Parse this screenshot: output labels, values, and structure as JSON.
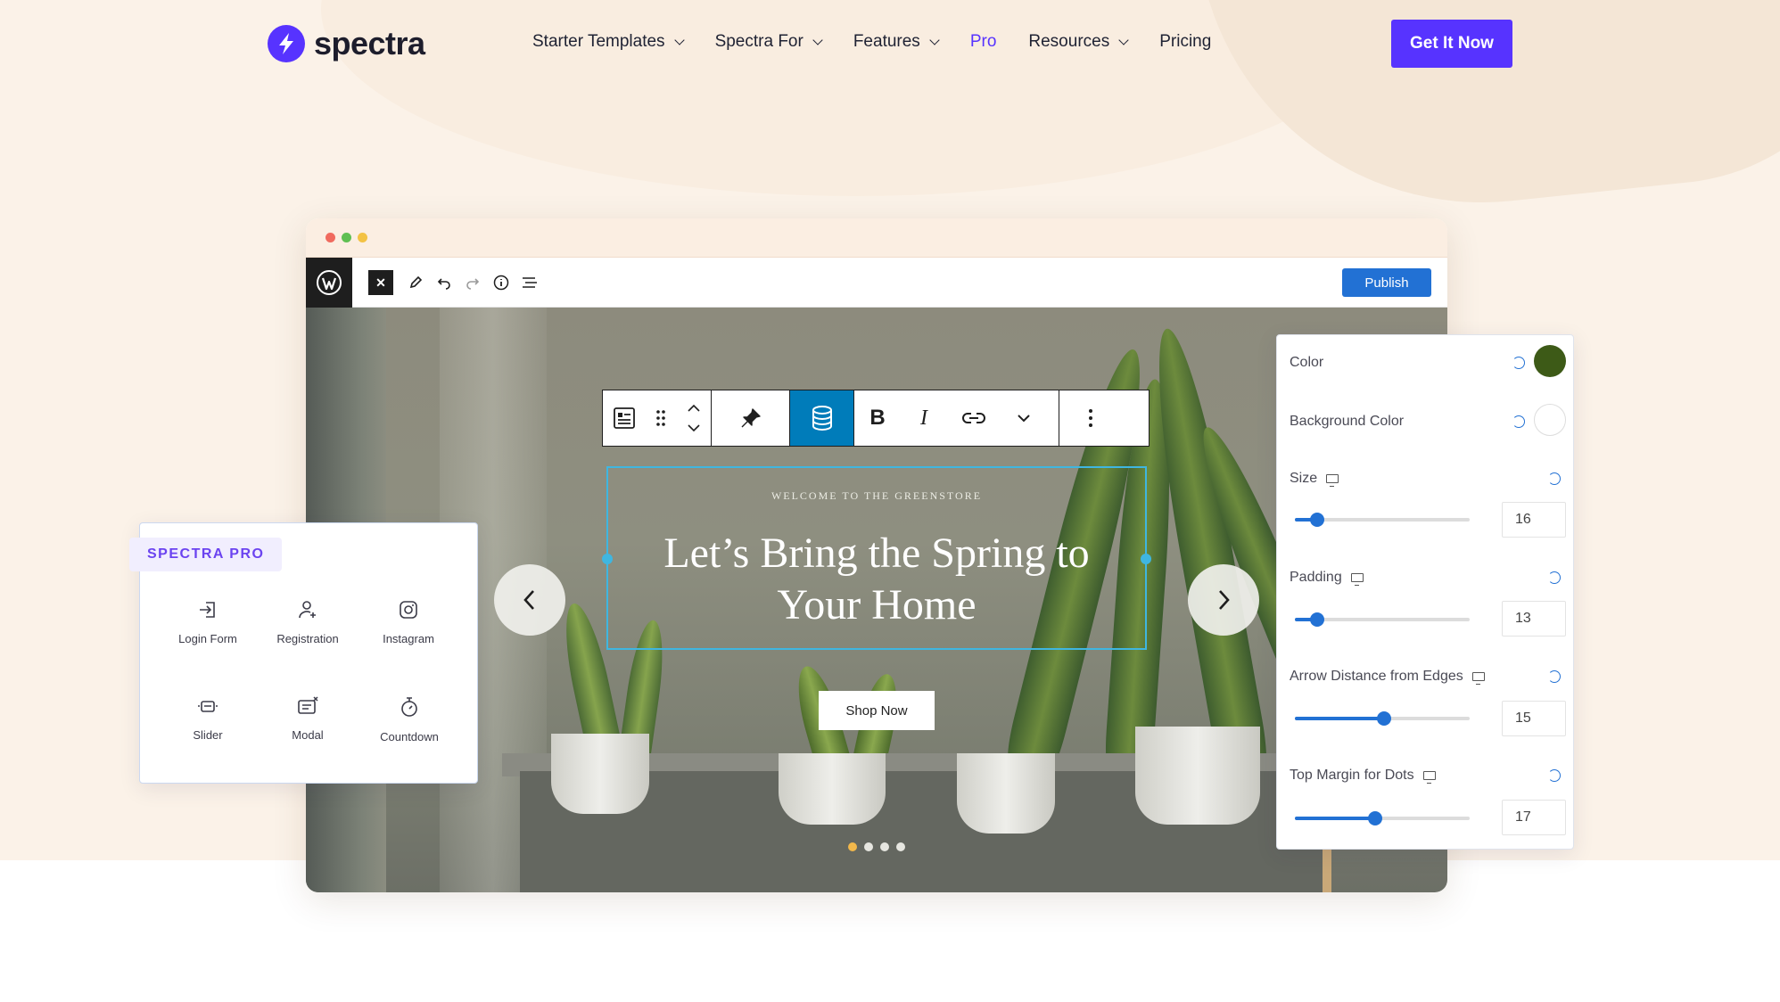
{
  "brand": {
    "name": "spectra",
    "accent": "#5733ff"
  },
  "nav": {
    "items": [
      {
        "label": "Starter Templates",
        "dropdown": true
      },
      {
        "label": "Spectra For",
        "dropdown": true
      },
      {
        "label": "Features",
        "dropdown": true
      },
      {
        "label": "Pro",
        "dropdown": false
      },
      {
        "label": "Resources",
        "dropdown": true
      },
      {
        "label": "Pricing",
        "dropdown": false
      }
    ],
    "cta_label": "Get It Now"
  },
  "editor": {
    "publish_label": "Publish",
    "toolbar_icons": [
      "block-icon",
      "drag-handle-icon",
      "move-up-down-icon",
      "pin-icon",
      "database-icon",
      "bold-icon",
      "italic-icon",
      "link-icon",
      "more-options-chevron-icon",
      "kebab-menu-icon"
    ],
    "slide": {
      "eyebrow": "WELCOME TO THE GREENSTORE",
      "headline": "Let’s Bring the Spring to Your Home",
      "button_label": "Shop Now",
      "dot_count": 4,
      "active_dot": 0
    }
  },
  "pro_card": {
    "badge": "SPECTRA PRO",
    "items": [
      {
        "label": "Login Form",
        "icon": "login-icon"
      },
      {
        "label": "Registration",
        "icon": "user-add-icon"
      },
      {
        "label": "Instagram",
        "icon": "instagram-icon"
      },
      {
        "label": "Slider",
        "icon": "slider-icon"
      },
      {
        "label": "Modal",
        "icon": "modal-icon"
      },
      {
        "label": "Countdown",
        "icon": "stopwatch-icon"
      }
    ]
  },
  "settings": {
    "color": {
      "label": "Color",
      "value": "#3d5a17"
    },
    "background_color": {
      "label": "Background Color",
      "value": "#ffffff"
    },
    "size": {
      "label": "Size",
      "value": "16",
      "fraction": 0.13
    },
    "padding": {
      "label": "Padding",
      "value": "13",
      "fraction": 0.13
    },
    "arrow_distance": {
      "label": "Arrow Distance from Edges",
      "value": "15",
      "fraction": 0.51
    },
    "top_margin_dots": {
      "label": "Top Margin for Dots",
      "value": "17",
      "fraction": 0.46
    }
  }
}
